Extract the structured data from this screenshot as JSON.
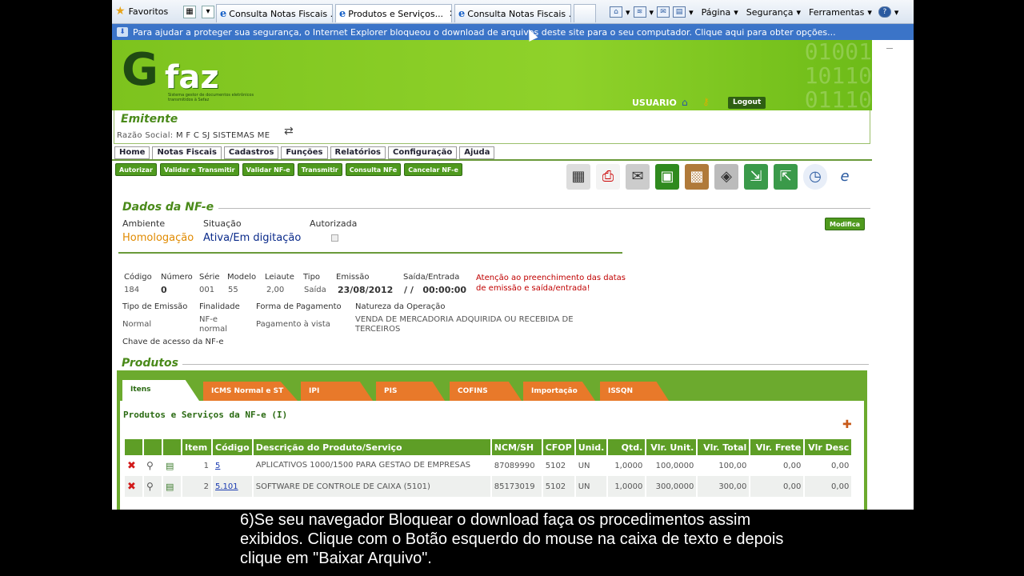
{
  "browser": {
    "favorites": "Favoritos",
    "tabs": [
      {
        "label": "Consulta Notas Fiscais ..."
      },
      {
        "label": "Produtos e Serviços..."
      },
      {
        "label": "Consulta Notas Fiscais ..."
      }
    ],
    "commands": [
      "Página",
      "Segurança",
      "Ferramentas"
    ],
    "infobar": "Para ajudar a proteger sua segurança, o Internet Explorer bloqueou o download de arquivos deste site para o seu computador. Clique aqui para obter opções..."
  },
  "banner": {
    "logo_g": "G",
    "logo_faz": "faz",
    "logo_sub": "Sistema gestor de documentos eletrônicos transmitidos à Sefaz",
    "user": "USUARIO",
    "logout": "Logout"
  },
  "emitente": {
    "title": "Emitente",
    "razao_label": "Razão Social:",
    "razao_value": "M F C SJ SISTEMAS ME"
  },
  "menu": [
    "Home",
    "Notas Fiscais",
    "Cadastros",
    "Funções",
    "Relatórios",
    "Configuração",
    "Ajuda"
  ],
  "actions": [
    "Autorizar",
    "Validar e Transmitir",
    "Validar NF-e",
    "Transmitir",
    "Consulta NFe",
    "Cancelar NF-e"
  ],
  "dados": {
    "title": "Dados da NF-e",
    "ambiente_label": "Ambiente",
    "situacao_label": "Situação",
    "autorizada_label": "Autorizada",
    "ambiente_value": "Homologação",
    "situacao_value": "Ativa/Em digitação",
    "modifica": "Modifica",
    "codigo_label": "Código",
    "numero_label": "Número",
    "serie_label": "Série",
    "modelo_label": "Modelo",
    "leiaute_label": "Leiaute",
    "tipo_label": "Tipo",
    "emissao_label": "Emissão",
    "saida_label": "Saída/Entrada",
    "codigo_value": "184",
    "numero_value": "0",
    "serie_value": "001",
    "modelo_value": "55",
    "leiaute_value": "2,00",
    "tipo_value": "Saída",
    "emissao_value": "23/08/2012",
    "saida_value": "/ /   00:00:00",
    "warning": "Atenção ao preenchimento das datas de emissão e saída/entrada!",
    "tipo_emissao_label": "Tipo de Emissão",
    "finalidade_label": "Finalidade",
    "forma_pag_label": "Forma de Pagamento",
    "natureza_label": "Natureza da Operação",
    "tipo_emissao_value": "Normal",
    "finalidade_value": "NF-e normal",
    "forma_pag_value": "Pagamento à vista",
    "natureza_value": "VENDA DE MERCADORIA ADQUIRIDA OU RECEBIDA DE TERCEIROS",
    "chave_label": "Chave de acesso da NF-e"
  },
  "produtos": {
    "title": "Produtos",
    "tabs": [
      "Itens",
      "ICMS Normal e ST",
      "IPI",
      "PIS",
      "COFINS",
      "Importação",
      "ISSQN"
    ],
    "subtitle": "Produtos e Serviços da NF-e (I)",
    "columns": [
      "Item",
      "Código",
      "Descrição do Produto/Serviço",
      "NCM/SH",
      "CFOP",
      "Unid.",
      "Qtd.",
      "Vlr. Unit.",
      "Vlr. Total",
      "Vlr. Frete",
      "Vlr Desc"
    ],
    "rows": [
      {
        "item": "1",
        "codigo": "5",
        "descricao": "APLICATIVOS 1000/1500 PARA GESTAO DE EMPRESAS",
        "ncm": "87089990",
        "cfop": "5102",
        "unid": "UN",
        "qtd": "1,0000",
        "vunit": "100,0000",
        "vtotal": "100,00",
        "vfrete": "0,00",
        "vdesc": "0,00"
      },
      {
        "item": "2",
        "codigo": "5.101",
        "descricao": "SOFTWARE DE CONTROLE DE CAIXA (5101)",
        "ncm": "85173019",
        "cfop": "5102",
        "unid": "UN",
        "qtd": "1,0000",
        "vunit": "300,0000",
        "vtotal": "300,00",
        "vfrete": "0,00",
        "vdesc": "0,00"
      }
    ]
  },
  "caption": "6)Se seu navegador Bloquear o download faça os procedimentos assim exibidos. Clique com o Botão esquerdo do mouse na caixa de texto e depois clique em \"Baixar Arquivo\"."
}
